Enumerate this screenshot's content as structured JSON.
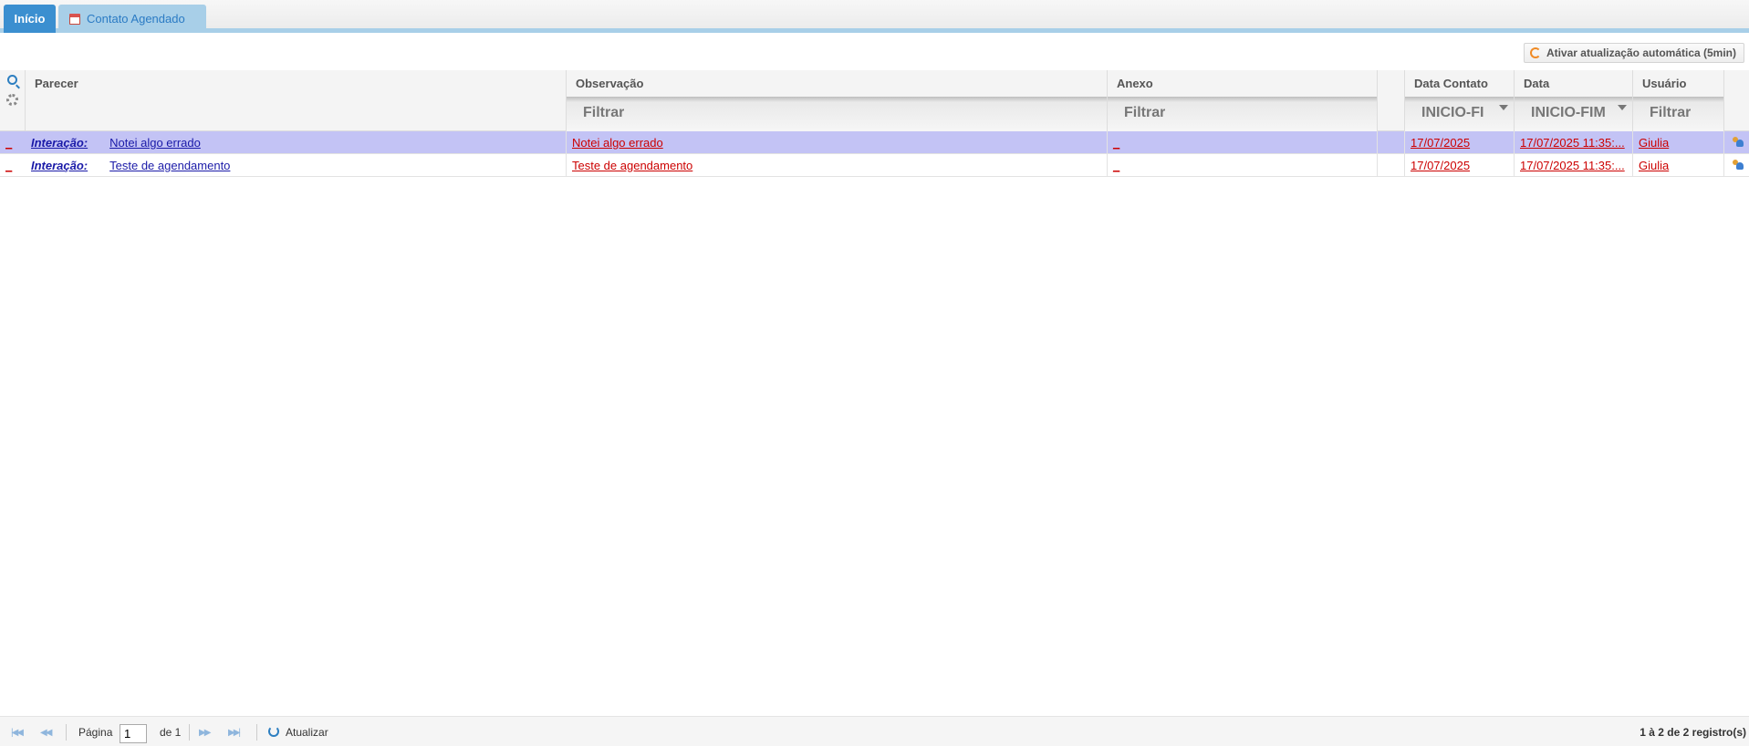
{
  "tabs": [
    {
      "label": "Início",
      "active": true
    },
    {
      "label": "Contato Agendado",
      "icon": "calendar-icon"
    }
  ],
  "toolbar": {
    "auto_refresh_label": "Ativar atualização automática (5min)"
  },
  "columns": [
    {
      "title": "Parecer",
      "filter": ""
    },
    {
      "title": "Observação",
      "filter": "Filtrar"
    },
    {
      "title": "Anexo",
      "filter": "Filtrar"
    },
    {
      "title": "",
      "filter": ""
    },
    {
      "title": "Data Contato",
      "filter": "INICIO-FI"
    },
    {
      "title": "Data",
      "filter": "INICIO-FIM"
    },
    {
      "title": "Usuário",
      "filter": "Filtrar"
    }
  ],
  "rows": [
    {
      "first": "_",
      "parecer_label": "Interação:",
      "parecer_text": "Notei algo errado",
      "observacao": "Notei algo errado",
      "anexo": "_",
      "data_contato": "17/07/2025",
      "data": "17/07/2025 11:35:...",
      "usuario": "Giulia",
      "selected": true
    },
    {
      "first": "_",
      "parecer_label": "Interação:",
      "parecer_text": "Teste de agendamento",
      "observacao": "Teste de agendamento",
      "anexo": "_",
      "data_contato": "17/07/2025",
      "data": "17/07/2025 11:35:...",
      "usuario": "Giulia",
      "selected": false
    }
  ],
  "footer": {
    "page_label": "Página",
    "page_value": "1",
    "of_label": "de 1",
    "refresh_label": "Atualizar",
    "count_label": "1 à 2 de 2 registro(s)"
  }
}
